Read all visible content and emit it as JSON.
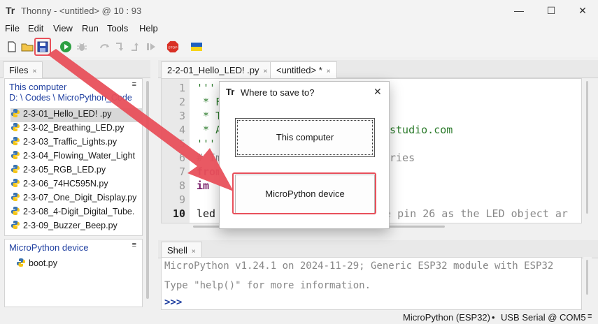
{
  "window": {
    "title": "Thonny  -  <untitled>  @  10 : 93",
    "app_icon": "thonny-icon",
    "controls": [
      "—",
      "☐",
      "✕"
    ]
  },
  "menu": [
    "File",
    "Edit",
    "View",
    "Run",
    "Tools",
    "Help"
  ],
  "toolbar": {
    "icons": [
      "new-file-icon",
      "open-file-icon",
      "save-icon",
      "run-icon",
      "debug-icon",
      "step-over-icon",
      "step-into-icon",
      "step-out-icon",
      "resume-icon",
      "stop-icon",
      "flag-icon"
    ],
    "stop_label": "STOP"
  },
  "files_pane": {
    "tab_label": "Files",
    "menu_glyph": "≡",
    "computer_header": "This computer",
    "computer_path": "D: \\ Codes \\ MicroPython_Code",
    "computer_files": [
      "2-3-01_Hello_LED! .py",
      "2-3-02_Breathing_LED.py",
      "2-3-03_Traffic_Lights.py",
      "2-3-04_Flowing_Water_Light",
      "2-3-05_RGB_LED.py",
      "2-3-06_74HC595N.py",
      "2-3-07_One_Digit_Display.py",
      "2-3-08_4-Digit_Digital_Tube.",
      "2-3-09_Buzzer_Beep.py"
    ],
    "device_header": "MicroPython device",
    "device_files": [
      "boot.py"
    ]
  },
  "editor": {
    "tabs": [
      {
        "label": "2-2-01_Hello_LED! .py",
        "close": "×"
      },
      {
        "label": "<untitled> *",
        "close": "×"
      }
    ],
    "line_numbers": [
      "1",
      "2",
      "3",
      "4",
      "5",
      "6",
      "7",
      "8",
      "9",
      "10"
    ],
    "lines": {
      "l1": "'''",
      "l2": " * F",
      "l3": " * T",
      "l4a": " * A",
      "l4b": "studio.com",
      "l5": "'''",
      "l6a": "# Im",
      "l6b": "ries",
      "l7": "from",
      "l8": "im",
      "l9": "",
      "l10a": "led",
      "l10b": "te pin 26 as the LED object ar"
    }
  },
  "shell": {
    "tab_label": "Shell",
    "line1": "MicroPython v1.24.1 on 2024-11-29; Generic ESP32 module with ESP32",
    "line2": "Type \"help()\" for more information.",
    "prompt": ">>>"
  },
  "status": {
    "interpreter": "MicroPython (ESP32)",
    "separator": "•",
    "port": "USB Serial @ COM5",
    "menu_glyph": "≡"
  },
  "dialog": {
    "title": "Where to save to?",
    "close": "✕",
    "option_computer": "This computer",
    "option_device": "MicroPython device"
  },
  "colors": {
    "annotation": "#e8505b",
    "path_blue": "#1f3fa0"
  }
}
